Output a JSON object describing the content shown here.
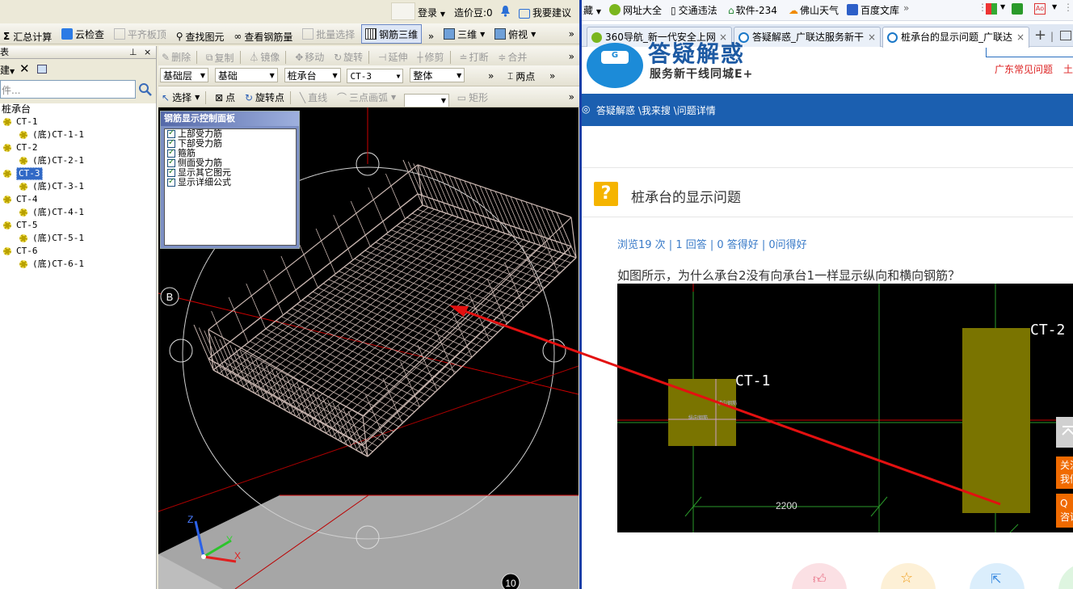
{
  "app": {
    "top_bar": {
      "login": "登录",
      "credits": "造价豆:0",
      "suggest": "我要建议"
    },
    "toolbar1": {
      "sum": "汇总计算",
      "cloud_check": "云检查",
      "level_top": "平齐板顶",
      "find_element": "查找图元",
      "view_rebar_qty": "查看钢筋量",
      "batch_select": "批量选择",
      "rebar_3d": "钢筋三维",
      "three_d": "三维",
      "top_view": "俯视"
    },
    "panel_title": "表",
    "panel_pin": "ㅁ",
    "panel_close": "×",
    "panel_search_placeholder": "件...",
    "toolbar2": {
      "delete": "删除",
      "copy": "复制",
      "mirror": "镜像",
      "move": "移动",
      "rotate": "旋转",
      "extend": "延伸",
      "trim": "修剪",
      "break": "打断",
      "merge": "合并"
    },
    "toolbar3": {
      "layer": "基础层",
      "type": "基础",
      "component": "桩承台",
      "item": "CT-3",
      "scope": "整体",
      "two_points": "两点"
    },
    "toolbar4": {
      "select": "选择",
      "point": "点",
      "rot_point": "旋转点",
      "line": "直线",
      "arc": "三点画弧",
      "rect": "矩形"
    },
    "tree": {
      "root": "桩承台",
      "items": [
        {
          "name": "CT-1",
          "child": "(底)CT-1-1"
        },
        {
          "name": "CT-2",
          "child": "(底)CT-2-1"
        },
        {
          "name": "CT-3",
          "child": "(底)CT-3-1"
        },
        {
          "name": "CT-4",
          "child": "(底)CT-4-1"
        },
        {
          "name": "CT-5",
          "child": "(底)CT-5-1"
        },
        {
          "name": "CT-6",
          "child": "(底)CT-6-1"
        }
      ]
    },
    "control_panel": {
      "title": "钢筋显示控制面板",
      "options": [
        "上部受力筋",
        "下部受力筋",
        "箍筋",
        "侧面受力筋",
        "显示其它图元",
        "显示详细公式"
      ]
    },
    "viewport": {
      "axis_b": "B",
      "axis_10": "10",
      "z": "Z",
      "y": "Y",
      "x": "X"
    }
  },
  "browser": {
    "favbar": [
      "网址大全",
      "交通违法",
      "软件-234",
      "佛山天气",
      "百度文库"
    ],
    "tabs": [
      "360导航_新一代安全上网",
      "答疑解惑_广联达服务新干",
      "桩承台的显示问题_广联达"
    ],
    "site": {
      "logo_text": "答疑解惑",
      "slogan": "服务新干线同城E+",
      "region_link": "广东常见问题",
      "region_link2": "土"
    },
    "breadcrumb": "答疑解惑 \\我来搜 \\问题详情",
    "question": {
      "title": "桩承台的显示问题",
      "stats": "浏览19 次 | 1 回答 | 0 答得好 | 0问得好",
      "body": "如图所示，为什么承台2没有向承台1一样显示纵向和横向钢筋？"
    },
    "figure": {
      "label1": "CT-1",
      "label2": "CT-2",
      "dim": "2200",
      "small_text1": "纵向钢筋",
      "small_text2": "横向钢筋"
    },
    "side": {
      "follow": "关注",
      "follow2": "我们",
      "qq": "Q",
      "consult": "咨询"
    }
  }
}
